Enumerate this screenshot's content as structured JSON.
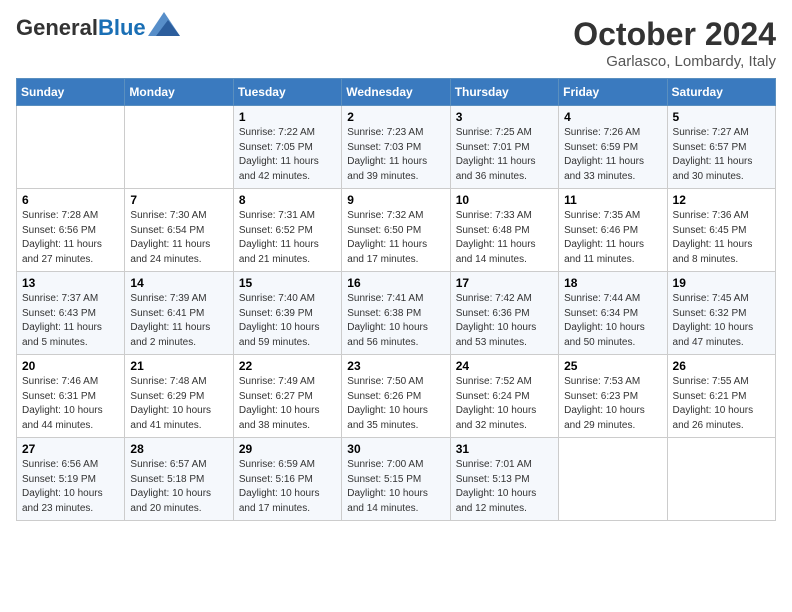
{
  "header": {
    "logo_line1": "General",
    "logo_line2": "Blue",
    "month": "October 2024",
    "location": "Garlasco, Lombardy, Italy"
  },
  "days_of_week": [
    "Sunday",
    "Monday",
    "Tuesday",
    "Wednesday",
    "Thursday",
    "Friday",
    "Saturday"
  ],
  "weeks": [
    [
      {
        "day": "",
        "info": ""
      },
      {
        "day": "",
        "info": ""
      },
      {
        "day": "1",
        "info": "Sunrise: 7:22 AM\nSunset: 7:05 PM\nDaylight: 11 hours\nand 42 minutes."
      },
      {
        "day": "2",
        "info": "Sunrise: 7:23 AM\nSunset: 7:03 PM\nDaylight: 11 hours\nand 39 minutes."
      },
      {
        "day": "3",
        "info": "Sunrise: 7:25 AM\nSunset: 7:01 PM\nDaylight: 11 hours\nand 36 minutes."
      },
      {
        "day": "4",
        "info": "Sunrise: 7:26 AM\nSunset: 6:59 PM\nDaylight: 11 hours\nand 33 minutes."
      },
      {
        "day": "5",
        "info": "Sunrise: 7:27 AM\nSunset: 6:57 PM\nDaylight: 11 hours\nand 30 minutes."
      }
    ],
    [
      {
        "day": "6",
        "info": "Sunrise: 7:28 AM\nSunset: 6:56 PM\nDaylight: 11 hours\nand 27 minutes."
      },
      {
        "day": "7",
        "info": "Sunrise: 7:30 AM\nSunset: 6:54 PM\nDaylight: 11 hours\nand 24 minutes."
      },
      {
        "day": "8",
        "info": "Sunrise: 7:31 AM\nSunset: 6:52 PM\nDaylight: 11 hours\nand 21 minutes."
      },
      {
        "day": "9",
        "info": "Sunrise: 7:32 AM\nSunset: 6:50 PM\nDaylight: 11 hours\nand 17 minutes."
      },
      {
        "day": "10",
        "info": "Sunrise: 7:33 AM\nSunset: 6:48 PM\nDaylight: 11 hours\nand 14 minutes."
      },
      {
        "day": "11",
        "info": "Sunrise: 7:35 AM\nSunset: 6:46 PM\nDaylight: 11 hours\nand 11 minutes."
      },
      {
        "day": "12",
        "info": "Sunrise: 7:36 AM\nSunset: 6:45 PM\nDaylight: 11 hours\nand 8 minutes."
      }
    ],
    [
      {
        "day": "13",
        "info": "Sunrise: 7:37 AM\nSunset: 6:43 PM\nDaylight: 11 hours\nand 5 minutes."
      },
      {
        "day": "14",
        "info": "Sunrise: 7:39 AM\nSunset: 6:41 PM\nDaylight: 11 hours\nand 2 minutes."
      },
      {
        "day": "15",
        "info": "Sunrise: 7:40 AM\nSunset: 6:39 PM\nDaylight: 10 hours\nand 59 minutes."
      },
      {
        "day": "16",
        "info": "Sunrise: 7:41 AM\nSunset: 6:38 PM\nDaylight: 10 hours\nand 56 minutes."
      },
      {
        "day": "17",
        "info": "Sunrise: 7:42 AM\nSunset: 6:36 PM\nDaylight: 10 hours\nand 53 minutes."
      },
      {
        "day": "18",
        "info": "Sunrise: 7:44 AM\nSunset: 6:34 PM\nDaylight: 10 hours\nand 50 minutes."
      },
      {
        "day": "19",
        "info": "Sunrise: 7:45 AM\nSunset: 6:32 PM\nDaylight: 10 hours\nand 47 minutes."
      }
    ],
    [
      {
        "day": "20",
        "info": "Sunrise: 7:46 AM\nSunset: 6:31 PM\nDaylight: 10 hours\nand 44 minutes."
      },
      {
        "day": "21",
        "info": "Sunrise: 7:48 AM\nSunset: 6:29 PM\nDaylight: 10 hours\nand 41 minutes."
      },
      {
        "day": "22",
        "info": "Sunrise: 7:49 AM\nSunset: 6:27 PM\nDaylight: 10 hours\nand 38 minutes."
      },
      {
        "day": "23",
        "info": "Sunrise: 7:50 AM\nSunset: 6:26 PM\nDaylight: 10 hours\nand 35 minutes."
      },
      {
        "day": "24",
        "info": "Sunrise: 7:52 AM\nSunset: 6:24 PM\nDaylight: 10 hours\nand 32 minutes."
      },
      {
        "day": "25",
        "info": "Sunrise: 7:53 AM\nSunset: 6:23 PM\nDaylight: 10 hours\nand 29 minutes."
      },
      {
        "day": "26",
        "info": "Sunrise: 7:55 AM\nSunset: 6:21 PM\nDaylight: 10 hours\nand 26 minutes."
      }
    ],
    [
      {
        "day": "27",
        "info": "Sunrise: 6:56 AM\nSunset: 5:19 PM\nDaylight: 10 hours\nand 23 minutes."
      },
      {
        "day": "28",
        "info": "Sunrise: 6:57 AM\nSunset: 5:18 PM\nDaylight: 10 hours\nand 20 minutes."
      },
      {
        "day": "29",
        "info": "Sunrise: 6:59 AM\nSunset: 5:16 PM\nDaylight: 10 hours\nand 17 minutes."
      },
      {
        "day": "30",
        "info": "Sunrise: 7:00 AM\nSunset: 5:15 PM\nDaylight: 10 hours\nand 14 minutes."
      },
      {
        "day": "31",
        "info": "Sunrise: 7:01 AM\nSunset: 5:13 PM\nDaylight: 10 hours\nand 12 minutes."
      },
      {
        "day": "",
        "info": ""
      },
      {
        "day": "",
        "info": ""
      }
    ]
  ]
}
